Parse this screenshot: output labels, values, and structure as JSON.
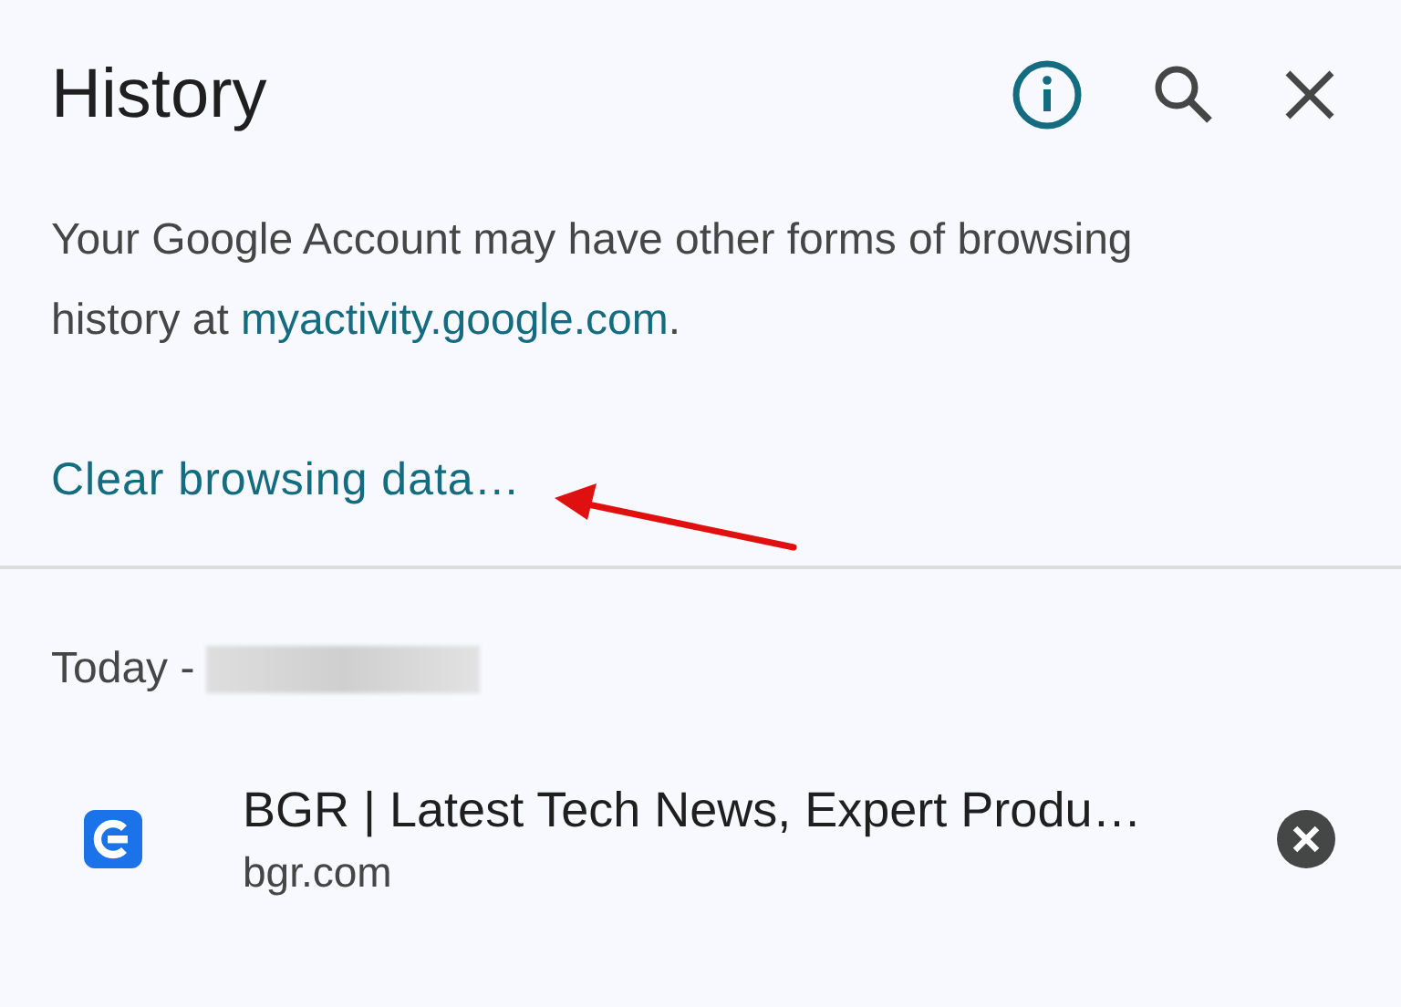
{
  "header": {
    "title": "History"
  },
  "notice": {
    "text_before": "Your Google Account may have other forms of browsing history at ",
    "link": "myactivity.google.com",
    "text_after": "."
  },
  "clear_link": "Clear browsing data…",
  "date_header": {
    "label": "Today -"
  },
  "entries": [
    {
      "title": "BGR | Latest Tech News, Expert Produ…",
      "url": "bgr.com"
    }
  ]
}
